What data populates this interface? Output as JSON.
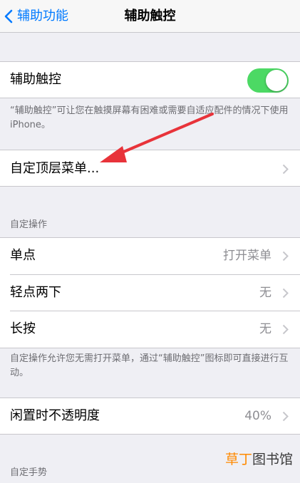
{
  "nav": {
    "back_label": "辅助功能",
    "title": "辅助触控"
  },
  "assistive_touch": {
    "label": "辅助触控",
    "enabled": true
  },
  "assistive_footer": "“辅助触控”可让您在触摸屏幕有困难或需要自适应配件的情况下使用 iPhone。",
  "customize_menu": {
    "label": "自定顶层菜单..."
  },
  "custom_actions": {
    "header": "自定操作",
    "rows": [
      {
        "label": "单点",
        "value": "打开菜单"
      },
      {
        "label": "轻点两下",
        "value": "无"
      },
      {
        "label": "长按",
        "value": "无"
      }
    ],
    "footer": "自定操作允许您无需打开菜单，通过“辅助触控”图标即可直接进行互动。"
  },
  "idle_opacity": {
    "label": "闲置时不透明度",
    "value": "40%"
  },
  "custom_gestures_header": "自定手势",
  "watermark": {
    "part1": "草丁",
    "part2": "图书馆"
  },
  "colors": {
    "accent": "#007aff",
    "toggle_on": "#4cd964",
    "arrow": "#e8333a",
    "watermark": "#ff8a00"
  }
}
